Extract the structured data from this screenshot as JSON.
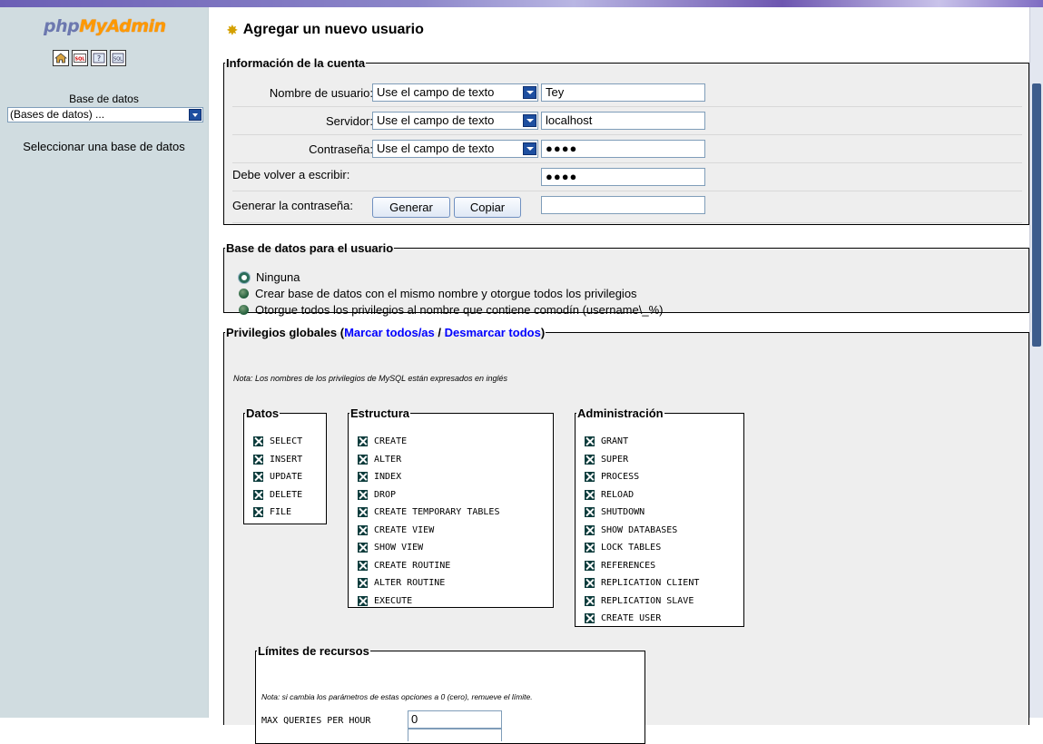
{
  "sidebar": {
    "logo_php": "php",
    "logo_myadmin": "MyAdmin",
    "icons": [
      "home-icon",
      "sql-icon",
      "help-icon",
      "query-window-icon"
    ],
    "db_label": "Base de datos",
    "db_select_value": "(Bases de datos) ...",
    "select_db_text": "Seleccionar una base de datos"
  },
  "page": {
    "title": "Agregar un nuevo usuario"
  },
  "account": {
    "legend": "Información de la cuenta",
    "username_label": "Nombre de usuario:",
    "username_mode": "Use el campo de texto",
    "username_value": "Tey",
    "host_label": "Servidor:",
    "host_mode": "Use el campo de texto",
    "host_value": "localhost",
    "password_label": "Contraseña:",
    "password_mode": "Use el campo de texto",
    "password_value": "●●●●",
    "retype_label": "Debe volver a escribir:",
    "retype_value": "●●●●",
    "generate_label": "Generar la contraseña:",
    "generate_button": "Generar",
    "copy_button": "Copiar",
    "generated_value": ""
  },
  "database": {
    "legend": "Base de datos para el usuario",
    "options": [
      "Ninguna",
      "Crear base de datos con el mismo nombre y otorgue todos los privilegios",
      "Otorgue todos los privilegios al nombre que contiene comodín (username\\_%)"
    ],
    "selected_index": 0
  },
  "privileges": {
    "legend": "Privilegios globales",
    "check_all": "Marcar todos/as",
    "separator": " / ",
    "uncheck_all": "Desmarcar todos",
    "note": "Nota: Los nombres de los privilegios de MySQL están expresados en inglés",
    "groups": {
      "data": {
        "legend": "Datos",
        "items": [
          "SELECT",
          "INSERT",
          "UPDATE",
          "DELETE",
          "FILE"
        ]
      },
      "structure": {
        "legend": "Estructura",
        "items": [
          "CREATE",
          "ALTER",
          "INDEX",
          "DROP",
          "CREATE TEMPORARY TABLES",
          "CREATE VIEW",
          "SHOW VIEW",
          "CREATE ROUTINE",
          "ALTER ROUTINE",
          "EXECUTE"
        ]
      },
      "admin": {
        "legend": "Administración",
        "items": [
          "GRANT",
          "SUPER",
          "PROCESS",
          "RELOAD",
          "SHUTDOWN",
          "SHOW DATABASES",
          "LOCK TABLES",
          "REFERENCES",
          "REPLICATION CLIENT",
          "REPLICATION SLAVE",
          "CREATE USER"
        ]
      }
    }
  },
  "limits": {
    "legend": "Límites de recursos",
    "note": "Nota: si cambia los parámetros de estas opciones a 0 (cero), remueve el límite.",
    "max_queries_label": "MAX QUERIES PER HOUR",
    "max_queries_value": "0"
  }
}
